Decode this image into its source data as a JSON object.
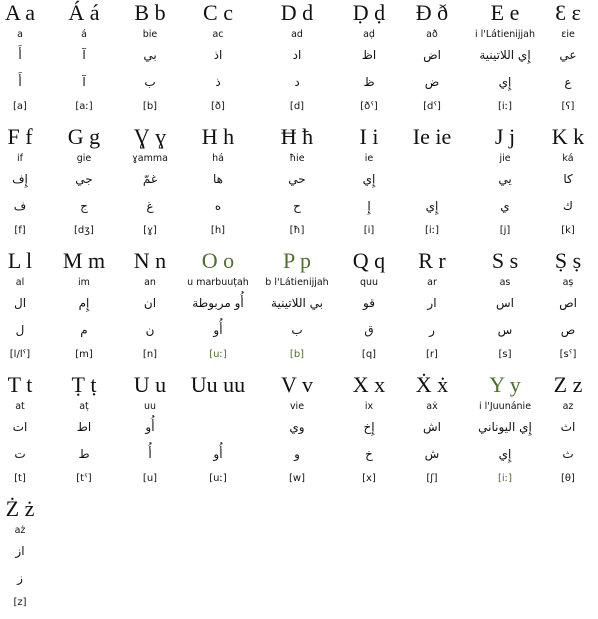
{
  "highlight_color": "#4f6f2f",
  "rows": [
    [
      {
        "letter": "A a",
        "name": "a",
        "ar_name": "أَ",
        "ar_letter": "أَ",
        "ipa": "[a]"
      },
      {
        "letter": "Á á",
        "name": "á",
        "ar_name": "آ",
        "ar_letter": "آ",
        "ipa": "[aː]"
      },
      {
        "letter": "B b",
        "name": "bie",
        "ar_name": "بي",
        "ar_letter": "ب",
        "ipa": "[b]"
      },
      {
        "letter": "C c",
        "name": "ac",
        "ar_name": "اذ",
        "ar_letter": "ذ",
        "ipa": "[ð]"
      },
      {
        "letter": "D d",
        "name": "ad",
        "ar_name": "اد",
        "ar_letter": "د",
        "ipa": "[d]"
      },
      {
        "letter": "Ḍ ḍ",
        "name": "aḍ",
        "ar_name": "اظ",
        "ar_letter": "ظ",
        "ipa": "[ðˤ]"
      },
      {
        "letter": "Đ ð",
        "name": "að",
        "ar_name": "اض",
        "ar_letter": "ض",
        "ipa": "[dˤ]"
      },
      {
        "letter": "E e",
        "name": "i l'Látienijjah",
        "ar_name": "إِي اللاتينية",
        "ar_letter": "إِي",
        "ipa": "[iː]"
      },
      {
        "letter": "Ɛ ɛ",
        "name": "ɛie",
        "ar_name": "عي",
        "ar_letter": "ع",
        "ipa": "[ʕ]"
      }
    ],
    [
      {
        "letter": "F f",
        "name": "if",
        "ar_name": "إِف",
        "ar_letter": "ف",
        "ipa": "[f]"
      },
      {
        "letter": "G g",
        "name": "gie",
        "ar_name": "جي",
        "ar_letter": "ج",
        "ipa": "[dʒ]"
      },
      {
        "letter": "Ɣ ɣ",
        "name": "ɣamma",
        "ar_name": "غمّ",
        "ar_letter": "غ",
        "ipa": "[ɣ]"
      },
      {
        "letter": "H h",
        "name": "há",
        "ar_name": "ها",
        "ar_letter": "ه",
        "ipa": "[h]"
      },
      {
        "letter": "Ħ ħ",
        "name": "ħie",
        "ar_name": "حي",
        "ar_letter": "ح",
        "ipa": "[ħ]"
      },
      {
        "letter": "I i",
        "name": "ie",
        "ar_name": "إِي",
        "ar_letter": "إِ",
        "ipa": "[i]"
      },
      {
        "letter": "Ie ie",
        "name": "",
        "ar_name": "",
        "ar_letter": "إِي",
        "ipa": "[iː]"
      },
      {
        "letter": "J j",
        "name": "jie",
        "ar_name": "يي",
        "ar_letter": "ي",
        "ipa": "[j]"
      },
      {
        "letter": "K k",
        "name": "ká",
        "ar_name": "كا",
        "ar_letter": "ك",
        "ipa": "[k]"
      }
    ],
    [
      {
        "letter": "L l",
        "name": "al",
        "ar_name": "ال",
        "ar_letter": "ل",
        "ipa": "[l/lˤ]"
      },
      {
        "letter": "M m",
        "name": "im",
        "ar_name": "إِم",
        "ar_letter": "م",
        "ipa": "[m]"
      },
      {
        "letter": "N n",
        "name": "an",
        "ar_name": "ان",
        "ar_letter": "ن",
        "ipa": "[n]"
      },
      {
        "letter": "O o",
        "name": "u marbuuṭah",
        "ar_name": "أُو مربوطة",
        "ar_letter": "أُو",
        "ipa": "[uː]",
        "highlight": true
      },
      {
        "letter": "P p",
        "name": "b l'Látienijjah",
        "ar_name": "بي اللاتينية",
        "ar_letter": "ب",
        "ipa": "[b]",
        "highlight": true
      },
      {
        "letter": "Q q",
        "name": "quu",
        "ar_name": "قو",
        "ar_letter": "ق",
        "ipa": "[q]"
      },
      {
        "letter": "R r",
        "name": "ar",
        "ar_name": "ار",
        "ar_letter": "ر",
        "ipa": "[r]"
      },
      {
        "letter": "S s",
        "name": "as",
        "ar_name": "اس",
        "ar_letter": "س",
        "ipa": "[s]"
      },
      {
        "letter": "Ṣ ṣ",
        "name": "aṣ",
        "ar_name": "اص",
        "ar_letter": "ص",
        "ipa": "[sˤ]"
      }
    ],
    [
      {
        "letter": "T t",
        "name": "at",
        "ar_name": "ات",
        "ar_letter": "ت",
        "ipa": "[t]"
      },
      {
        "letter": "Ṭ ṭ",
        "name": "aṭ",
        "ar_name": "اط",
        "ar_letter": "ط",
        "ipa": "[tˤ]"
      },
      {
        "letter": "U u",
        "name": "uu",
        "ar_name": "أُو",
        "ar_letter": "أُ",
        "ipa": "[u]"
      },
      {
        "letter": "Uu uu",
        "name": "",
        "ar_name": "",
        "ar_letter": "أُو",
        "ipa": "[uː]"
      },
      {
        "letter": "V v",
        "name": "vie",
        "ar_name": "وي",
        "ar_letter": "و",
        "ipa": "[w]"
      },
      {
        "letter": "X x",
        "name": "ix",
        "ar_name": "إِخ",
        "ar_letter": "خ",
        "ipa": "[x]"
      },
      {
        "letter": "Ẋ ẋ",
        "name": "aẋ",
        "ar_name": "اش",
        "ar_letter": "ش",
        "ipa": "[ʃ]"
      },
      {
        "letter": "Y y",
        "name": "i l'Juunánie",
        "ar_name": "إِي اليوناني",
        "ar_letter": "إِي",
        "ipa": "[iː]",
        "highlight": true
      },
      {
        "letter": "Z z",
        "name": "az",
        "ar_name": "اث",
        "ar_letter": "ث",
        "ipa": "[θ]"
      }
    ],
    [
      {
        "letter": "Ż ż",
        "name": "aż",
        "ar_name": "از",
        "ar_letter": "ز",
        "ipa": "[z]"
      }
    ]
  ]
}
